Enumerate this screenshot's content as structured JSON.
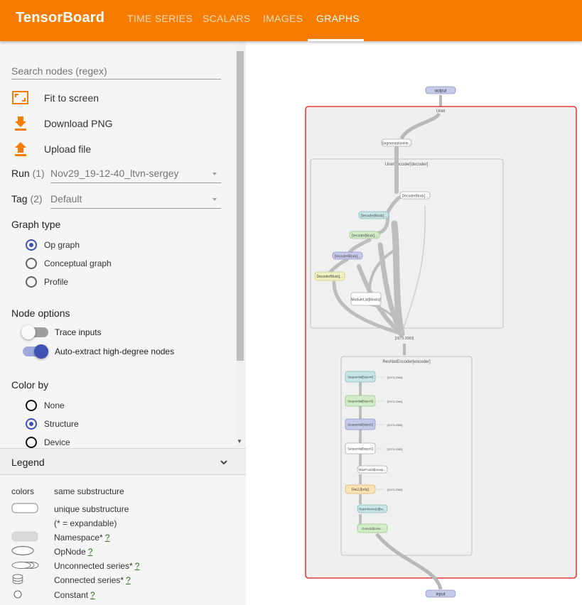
{
  "app": {
    "title": "TensorBoard",
    "tabs": [
      {
        "label": "TIME SERIES",
        "active": false
      },
      {
        "label": "SCALARS",
        "active": false
      },
      {
        "label": "IMAGES",
        "active": false
      },
      {
        "label": "GRAPHS",
        "active": true
      }
    ],
    "accent_color": "#f57c00"
  },
  "sidebar": {
    "search_placeholder": "Search nodes (regex)",
    "actions": {
      "fit": "Fit to screen",
      "download": "Download PNG",
      "upload": "Upload file"
    },
    "run": {
      "label": "Run",
      "count": "(1)",
      "value": "Nov29_19-12-40_ltvn-sergey"
    },
    "tag": {
      "label": "Tag",
      "count": "(2)",
      "value": "Default"
    },
    "graph_type": {
      "title": "Graph type",
      "options": [
        "Op graph",
        "Conceptual graph",
        "Profile"
      ],
      "selected": "Op graph"
    },
    "node_options": {
      "title": "Node options",
      "trace_inputs": {
        "label": "Trace inputs",
        "on": false
      },
      "auto_extract": {
        "label": "Auto-extract high-degree nodes",
        "on": true
      }
    },
    "color_by": {
      "title": "Color by",
      "options": [
        "None",
        "Structure",
        "Device"
      ],
      "selected": "Structure"
    }
  },
  "legend": {
    "title": "Legend",
    "colors_label": "colors",
    "same_substructure": "same substructure",
    "unique_substructure": "unique substructure",
    "expandable_note": "(* = expandable)",
    "items": [
      {
        "label": "Namespace*",
        "q": "?"
      },
      {
        "label": "OpNode",
        "q": "?"
      },
      {
        "label": "Unconnected series*",
        "q": "?"
      },
      {
        "label": "Connected series*",
        "q": "?"
      },
      {
        "label": "Constant",
        "q": "?"
      }
    ]
  },
  "graph": {
    "output": "output",
    "input": "input",
    "unet": "Unet",
    "segmentation_head": "SegmentationHe...",
    "decoder_ns": "UnetDecoder[decoder]",
    "encoder_ns": "ResNetEncoder[encoder]",
    "decoder_blocks": [
      "DecoderBlock[...",
      "DecoderBlock[...",
      "DecoderBlock[...",
      "DecoderBlock[...",
      "DecoderBlock[..."
    ],
    "module_list": "ModuleList[blocks]",
    "series_label": "[2073-2083]",
    "encoder_layers": [
      "Sequential[layer4]",
      "Sequential[layer3]",
      "Sequential[layer2]",
      "Sequential[layer1]",
      "MaxPool2d[maxp...",
      "ReLU[relu]",
      "BatchNorm2d[bn...",
      "Conv2d[conv..."
    ],
    "encoder_side_label": "[2073-2083]",
    "selection_color": "#e53935"
  }
}
